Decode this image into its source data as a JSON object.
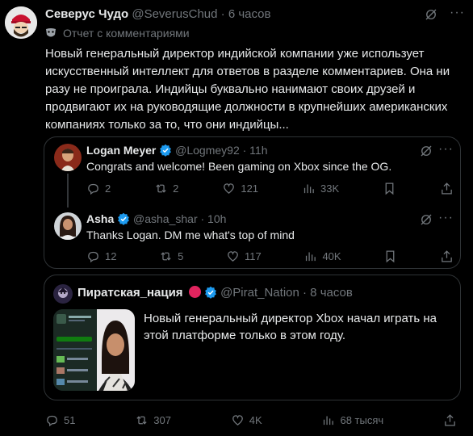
{
  "main_tweet": {
    "display_name": "Северус Чудо",
    "handle": "@SeverusChud",
    "time": "· 6 часов",
    "subtitle": "Отчет с комментариями",
    "text": "Новый генеральный директор индийской компании уже использует искусственный интеллект для ответов в разделе комментариев. Она ни разу не проиграла. Индийцы буквально нанимают своих друзей и продвигают их на руководящие должности в крупнейших американских компаниях только за то, что они индийцы...",
    "stats": {
      "replies": "51",
      "reposts": "307",
      "likes": "4K",
      "views": "68 тысяч"
    }
  },
  "thread": [
    {
      "display_name": "Logan Meyer",
      "handle": "@Logmey92",
      "time": "· 11h",
      "text": "Congrats and welcome! Been gaming on Xbox since the OG.",
      "stats": {
        "replies": "2",
        "reposts": "2",
        "likes": "121",
        "views": "33K"
      }
    },
    {
      "display_name": "Asha",
      "handle": "@asha_shar",
      "time": "· 10h",
      "text": "Thanks Logan. DM me what's top of mind",
      "stats": {
        "replies": "12",
        "reposts": "5",
        "likes": "117",
        "views": "40K"
      }
    }
  ],
  "quoted": {
    "display_name": "Пиратская_нация",
    "handle": "@Pirat_Nation",
    "time": "· 8 часов",
    "text": "Новый генеральный директор Xbox начал играть на этой платформе только в этом году."
  },
  "colors": {
    "accent": "#1d9bf0",
    "muted": "#71767b",
    "border": "#2f3336",
    "flag": "#e0245e"
  }
}
